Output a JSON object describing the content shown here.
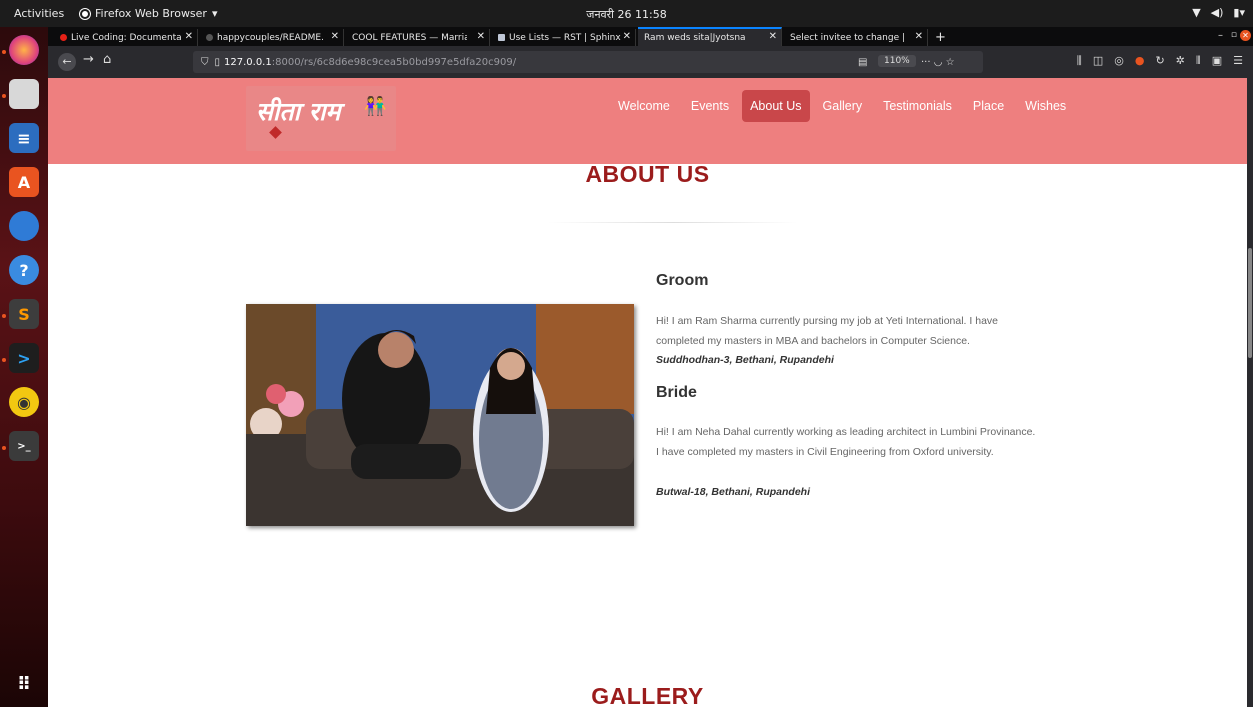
{
  "system": {
    "activities": "Activities",
    "app_name": "Firefox Web Browser",
    "clock": "जनवरी 26  11:58"
  },
  "tabs": [
    {
      "label": "Live Coding: Documenta",
      "icon_color": "#e62117"
    },
    {
      "label": "happycouples/README.",
      "icon_color": "#555555"
    },
    {
      "label": "COOL FEATURES — Marriag",
      "icon_color": ""
    },
    {
      "label": "Use Lists — RST | Sphinx",
      "icon_color": "#bfc7d6"
    },
    {
      "label": "Ram weds sita|Jyotsna",
      "icon_color": ""
    },
    {
      "label": "Select invitee to change | D",
      "icon_color": ""
    }
  ],
  "url": {
    "host": "127.0.0.1",
    "path": ":8000/rs/6c8d6e98c9cea5b0bd997e5dfa20c909/",
    "zoom": "110%"
  },
  "site": {
    "logo_text": "सीता राम",
    "nav": [
      "Welcome",
      "Events",
      "About Us",
      "Gallery",
      "Testimonials",
      "Place",
      "Wishes"
    ],
    "active_nav": "About Us",
    "header_color": "#ee7f7f",
    "title_color": "#9b1c1c"
  },
  "about": {
    "title": "ABOUT US",
    "groom": {
      "heading": "Groom",
      "description": "Hi! I am Ram Sharma currently pursing my job at Yeti International. I have completed my masters in MBA and bachelors in Computer Science.",
      "address": "Suddhodhan-3, Bethani, Rupandehi"
    },
    "bride": {
      "heading": "Bride",
      "description": "Hi! I am Neha Dahal currently working as leading architect in Lumbini Provinance. I have completed my masters in Civil Engineering from Oxford university.",
      "address": "Butwal-18, Bethani, Rupandehi"
    }
  },
  "gallery": {
    "title": "GALLERY"
  }
}
